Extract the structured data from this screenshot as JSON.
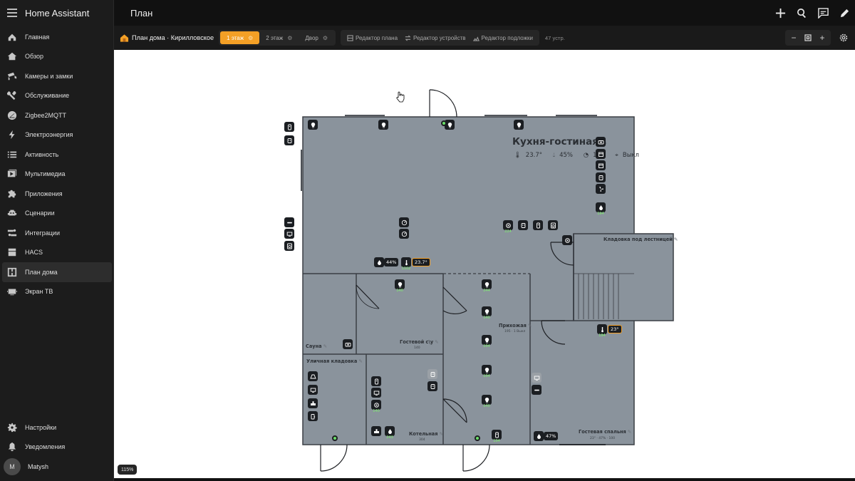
{
  "app_title": "Home Assistant",
  "page_title": "План",
  "sidebar": {
    "items": [
      {
        "label": "Главная",
        "icon": "home-icon"
      },
      {
        "label": "Обзор",
        "icon": "house-icon"
      },
      {
        "label": "Камеры и замки",
        "icon": "cctv-icon"
      },
      {
        "label": "Обслуживание",
        "icon": "tools-icon"
      },
      {
        "label": "Zigbee2MQTT",
        "icon": "zigbee-icon"
      },
      {
        "label": "Электроэнергия",
        "icon": "lightning-icon"
      },
      {
        "label": "Активность",
        "icon": "list-icon"
      },
      {
        "label": "Мультимедиа",
        "icon": "media-icon"
      },
      {
        "label": "Приложения",
        "icon": "puzzle-icon"
      },
      {
        "label": "Сценарии",
        "icon": "robot-icon"
      },
      {
        "label": "Интеграции",
        "icon": "integrations-icon"
      },
      {
        "label": "HACS",
        "icon": "hacs-icon"
      },
      {
        "label": "План дома",
        "icon": "floorplan-icon",
        "active": true
      },
      {
        "label": "Экран ТВ",
        "icon": "tv-icon"
      }
    ],
    "bottom": [
      {
        "label": "Настройки",
        "icon": "gear-icon"
      },
      {
        "label": "Уведомления",
        "icon": "bell-icon"
      }
    ],
    "user": {
      "initial": "M",
      "name": "Matysh"
    }
  },
  "toolbar": {
    "plan_name": "План дома · Кирилловское",
    "floors": [
      {
        "label": "1 этаж",
        "active": true
      },
      {
        "label": "2 этаж",
        "active": false
      },
      {
        "label": "Двор",
        "active": false
      }
    ],
    "editors": [
      "Редактор плана",
      "Редактор устройств",
      "Редактор подложки"
    ],
    "device_count": "47 устр.",
    "zoom_out": "−",
    "zoom_in": "+"
  },
  "zoom_level": "115%",
  "rooms": {
    "kitchen": {
      "name": "Кухня-гостиная",
      "temp": "23.7°",
      "humidity": "45%",
      "power": "197",
      "presence": "Выкл"
    },
    "stair_storage": {
      "name": "Кладовка под лестницей"
    },
    "hallway": {
      "name": "Прихожая",
      "sub": "195 · 1 Выкл"
    },
    "sauna": {
      "name": "Сауна"
    },
    "guest_wc": {
      "name": "Гостевой с\\у",
      "sub": "140"
    },
    "street_storage": {
      "name": "Уличная кладовка"
    },
    "boiler": {
      "name": "Котельная",
      "sub": "304"
    },
    "guest_bedroom": {
      "name": "Гостевая спальня",
      "sub": "23° · 47% · 100"
    }
  },
  "badges": {
    "kitchen_humidity": "44%",
    "kitchen_temp": "23.7°",
    "bedroom_temp": "23°",
    "bedroom_humidity": "47%"
  },
  "counts": {
    "c1": "194",
    "c2": "224",
    "c3": "1102",
    "c4": "140",
    "c5": "244",
    "c6": "140",
    "c7": "194",
    "c8": "194",
    "c9": "140",
    "c10": "194",
    "c11": "140",
    "c12": "243",
    "c13": "194"
  },
  "colors": {
    "accent": "#f4a026",
    "floor_fill": "#8a939c",
    "wall": "#3a3e44",
    "sidebar_bg": "#1c1c1c",
    "count_green": "#7cf06a"
  }
}
